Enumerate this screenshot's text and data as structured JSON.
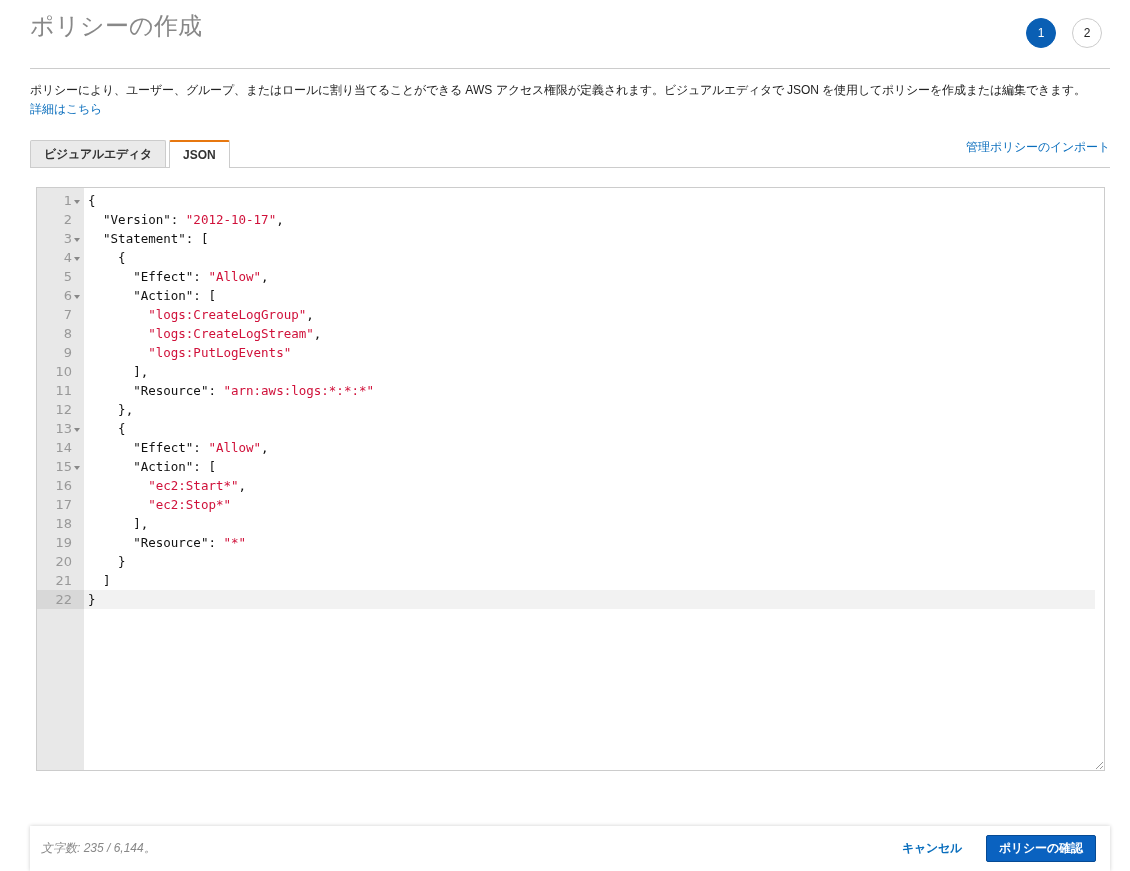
{
  "header": {
    "title": "ポリシーの作成",
    "steps": [
      {
        "label": "1",
        "selected": true
      },
      {
        "label": "2",
        "selected": false
      }
    ]
  },
  "description": {
    "text": "ポリシーにより、ユーザー、グループ、またはロールに割り当てることができる AWS アクセス権限が定義されます。ビジュアルエディタで JSON を使用してポリシーを作成または編集できます。",
    "link": "詳細はこちら"
  },
  "tabs": [
    {
      "label": "ビジュアルエディタ",
      "selected": false
    },
    {
      "label": "JSON",
      "selected": true
    }
  ],
  "import_link": "管理ポリシーのインポート",
  "editor": {
    "lines": [
      {
        "number": "1",
        "foldable": true,
        "current": false,
        "tokens": [
          {
            "kind": "plain",
            "text": "{"
          }
        ]
      },
      {
        "number": "2",
        "foldable": false,
        "current": false,
        "tokens": [
          {
            "kind": "plain",
            "text": "  \"Version\": "
          },
          {
            "kind": "string",
            "text": "\"2012-10-17\""
          },
          {
            "kind": "plain",
            "text": ","
          }
        ]
      },
      {
        "number": "3",
        "foldable": true,
        "current": false,
        "tokens": [
          {
            "kind": "plain",
            "text": "  \"Statement\": ["
          }
        ]
      },
      {
        "number": "4",
        "foldable": true,
        "current": false,
        "tokens": [
          {
            "kind": "plain",
            "text": "    {"
          }
        ]
      },
      {
        "number": "5",
        "foldable": false,
        "current": false,
        "tokens": [
          {
            "kind": "plain",
            "text": "      \"Effect\": "
          },
          {
            "kind": "string",
            "text": "\"Allow\""
          },
          {
            "kind": "plain",
            "text": ","
          }
        ]
      },
      {
        "number": "6",
        "foldable": true,
        "current": false,
        "tokens": [
          {
            "kind": "plain",
            "text": "      \"Action\": ["
          }
        ]
      },
      {
        "number": "7",
        "foldable": false,
        "current": false,
        "tokens": [
          {
            "kind": "string",
            "text": "        \"logs:CreateLogGroup\""
          },
          {
            "kind": "plain",
            "text": ","
          }
        ]
      },
      {
        "number": "8",
        "foldable": false,
        "current": false,
        "tokens": [
          {
            "kind": "string",
            "text": "        \"logs:CreateLogStream\""
          },
          {
            "kind": "plain",
            "text": ","
          }
        ]
      },
      {
        "number": "9",
        "foldable": false,
        "current": false,
        "tokens": [
          {
            "kind": "string",
            "text": "        \"logs:PutLogEvents\""
          }
        ]
      },
      {
        "number": "10",
        "foldable": false,
        "current": false,
        "tokens": [
          {
            "kind": "plain",
            "text": "      ],"
          }
        ]
      },
      {
        "number": "11",
        "foldable": false,
        "current": false,
        "tokens": [
          {
            "kind": "plain",
            "text": "      \"Resource\": "
          },
          {
            "kind": "string",
            "text": "\"arn:aws:logs:*:*:*\""
          }
        ]
      },
      {
        "number": "12",
        "foldable": false,
        "current": false,
        "tokens": [
          {
            "kind": "plain",
            "text": "    },"
          }
        ]
      },
      {
        "number": "13",
        "foldable": true,
        "current": false,
        "tokens": [
          {
            "kind": "plain",
            "text": "    {"
          }
        ]
      },
      {
        "number": "14",
        "foldable": false,
        "current": false,
        "tokens": [
          {
            "kind": "plain",
            "text": "      \"Effect\": "
          },
          {
            "kind": "string",
            "text": "\"Allow\""
          },
          {
            "kind": "plain",
            "text": ","
          }
        ]
      },
      {
        "number": "15",
        "foldable": true,
        "current": false,
        "tokens": [
          {
            "kind": "plain",
            "text": "      \"Action\": ["
          }
        ]
      },
      {
        "number": "16",
        "foldable": false,
        "current": false,
        "tokens": [
          {
            "kind": "string",
            "text": "        \"ec2:Start*\""
          },
          {
            "kind": "plain",
            "text": ","
          }
        ]
      },
      {
        "number": "17",
        "foldable": false,
        "current": false,
        "tokens": [
          {
            "kind": "string",
            "text": "        \"ec2:Stop*\""
          }
        ]
      },
      {
        "number": "18",
        "foldable": false,
        "current": false,
        "tokens": [
          {
            "kind": "plain",
            "text": "      ],"
          }
        ]
      },
      {
        "number": "19",
        "foldable": false,
        "current": false,
        "tokens": [
          {
            "kind": "plain",
            "text": "      \"Resource\": "
          },
          {
            "kind": "string",
            "text": "\"*\""
          }
        ]
      },
      {
        "number": "20",
        "foldable": false,
        "current": false,
        "tokens": [
          {
            "kind": "plain",
            "text": "    }"
          }
        ]
      },
      {
        "number": "21",
        "foldable": false,
        "current": false,
        "tokens": [
          {
            "kind": "plain",
            "text": "  ]"
          }
        ]
      },
      {
        "number": "22",
        "foldable": false,
        "current": true,
        "tokens": [
          {
            "kind": "plain",
            "text": "}"
          }
        ]
      }
    ]
  },
  "footer": {
    "char_count": "文字数: 235 / 6,144。",
    "cancel": "キャンセル",
    "confirm": "ポリシーの確認"
  }
}
